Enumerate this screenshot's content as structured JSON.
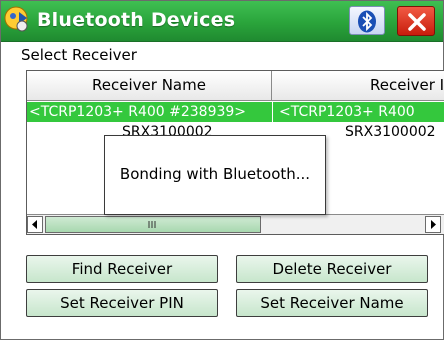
{
  "window": {
    "title": "Bluetooth Devices"
  },
  "section": {
    "label": "Select Receiver"
  },
  "table": {
    "columns": [
      "Receiver Name",
      "Receiver ID"
    ],
    "rows": [
      {
        "name": "<TCRP1203+ R400  #238939>",
        "id": "<TCRP1203+ R400",
        "selected": true
      },
      {
        "name": "SRX3100002",
        "id": "SRX3100002",
        "selected": false
      }
    ]
  },
  "dialog": {
    "message": "Bonding with Bluetooth..."
  },
  "buttons": {
    "find_receiver": "Find Receiver",
    "delete_receiver": "Delete Receiver",
    "set_pin": "Set Receiver PIN",
    "set_name": "Set Receiver Name"
  },
  "colors": {
    "titlebar": "#2aa43b",
    "selection": "#34c83d",
    "button_bg": "#c7e6cc",
    "close": "#d92b16"
  },
  "icons": [
    "app-icon",
    "bluetooth-icon",
    "close-icon",
    "arrow-left-icon",
    "arrow-right-icon"
  ]
}
